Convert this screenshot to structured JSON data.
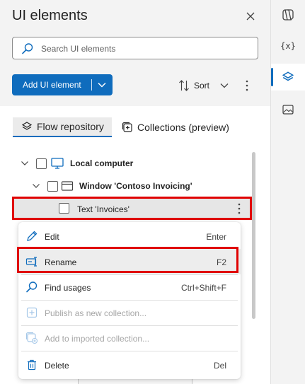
{
  "panel": {
    "title": "UI elements",
    "search": {
      "placeholder": "Search UI elements"
    },
    "add_button_label": "Add UI element",
    "sort_label": "Sort",
    "tabs": [
      {
        "label": "Flow repository",
        "active": true
      },
      {
        "label": "Collections (preview)",
        "active": false
      }
    ],
    "tree": {
      "local_computer": "Local computer",
      "window": "Window 'Contoso Invoicing'",
      "text_item": "Text 'Invoices'"
    }
  },
  "context_menu": {
    "items": [
      {
        "label": "Edit",
        "shortcut": "Enter",
        "icon": "pencil-icon",
        "disabled": false
      },
      {
        "label": "Rename",
        "shortcut": "F2",
        "icon": "rename-icon",
        "disabled": false
      },
      {
        "label": "Find usages",
        "shortcut": "Ctrl+Shift+F",
        "icon": "search-icon",
        "disabled": false
      },
      {
        "label": "Publish as new collection...",
        "shortcut": "",
        "icon": "add-square-icon",
        "disabled": true
      },
      {
        "label": "Add to imported collection...",
        "shortcut": "",
        "icon": "collection-add-icon",
        "disabled": true
      },
      {
        "label": "Delete",
        "shortcut": "Del",
        "icon": "trash-icon",
        "disabled": false
      }
    ]
  },
  "rail": {
    "items": [
      {
        "icon": "copilot-icon",
        "active": false
      },
      {
        "icon": "variables-icon",
        "label": "{x}",
        "active": false
      },
      {
        "icon": "layers-icon",
        "active": true
      },
      {
        "icon": "image-icon",
        "active": false
      }
    ]
  },
  "colors": {
    "accent": "#0f6cbd",
    "highlight": "#e00000"
  }
}
